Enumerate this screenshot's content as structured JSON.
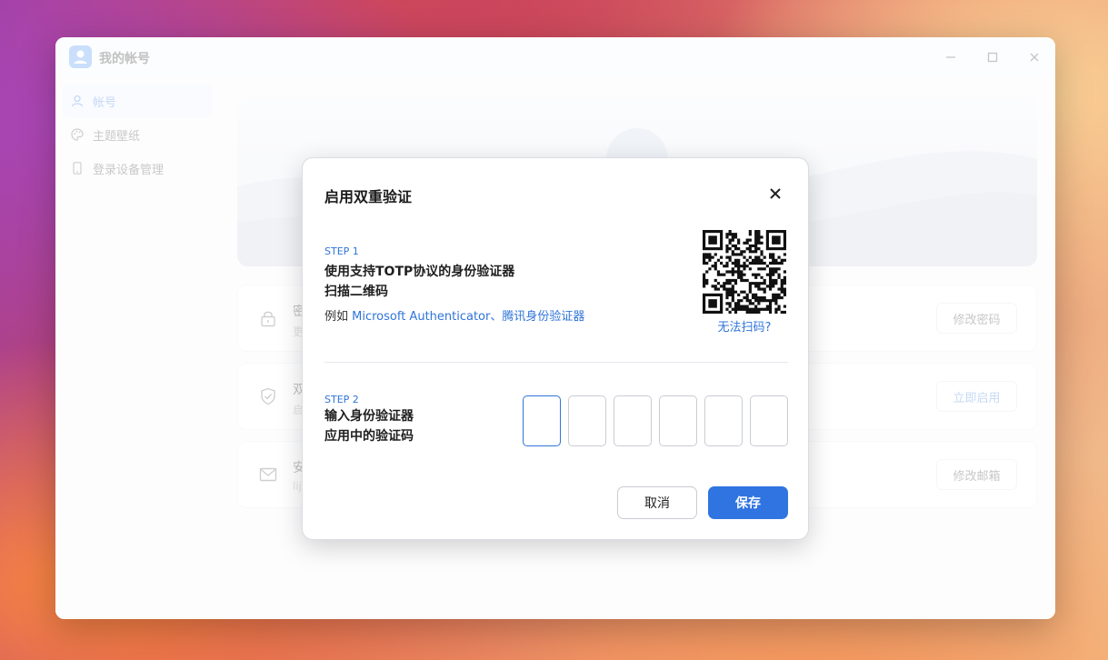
{
  "window": {
    "title": "我的帐号"
  },
  "sidebar": {
    "items": [
      {
        "label": "帐号",
        "icon": "user-icon",
        "active": true
      },
      {
        "label": "主题壁纸",
        "icon": "palette-icon",
        "active": false
      },
      {
        "label": "登录设备管理",
        "icon": "phone-icon",
        "active": false
      }
    ]
  },
  "main": {
    "cards": [
      {
        "title": "密",
        "subtitle": "更",
        "button": "修改密码",
        "icon": "lock-icon"
      },
      {
        "title": "双",
        "subtitle": "启",
        "button": "立即启用",
        "icon": "shield-check-icon"
      },
      {
        "title": "安",
        "subtitle": "lij",
        "button": "修改邮箱",
        "icon": "mail-icon"
      }
    ]
  },
  "dialog": {
    "title": "启用双重验证",
    "step1": {
      "label": "STEP 1",
      "line1": "使用支持TOTP协议的身份验证器",
      "line2": "扫描二维码",
      "example_prefix": "例如 ",
      "example_link": "Microsoft Authenticator、腾讯身份验证器",
      "qr_help": "无法扫码?"
    },
    "step2": {
      "label": "STEP 2",
      "line1": "输入身份验证器",
      "line2": "应用中的验证码",
      "code_digits": 6
    },
    "cancel_label": "取消",
    "save_label": "保存"
  },
  "colors": {
    "accent": "#2f74e0",
    "link": "#2f74d8"
  }
}
